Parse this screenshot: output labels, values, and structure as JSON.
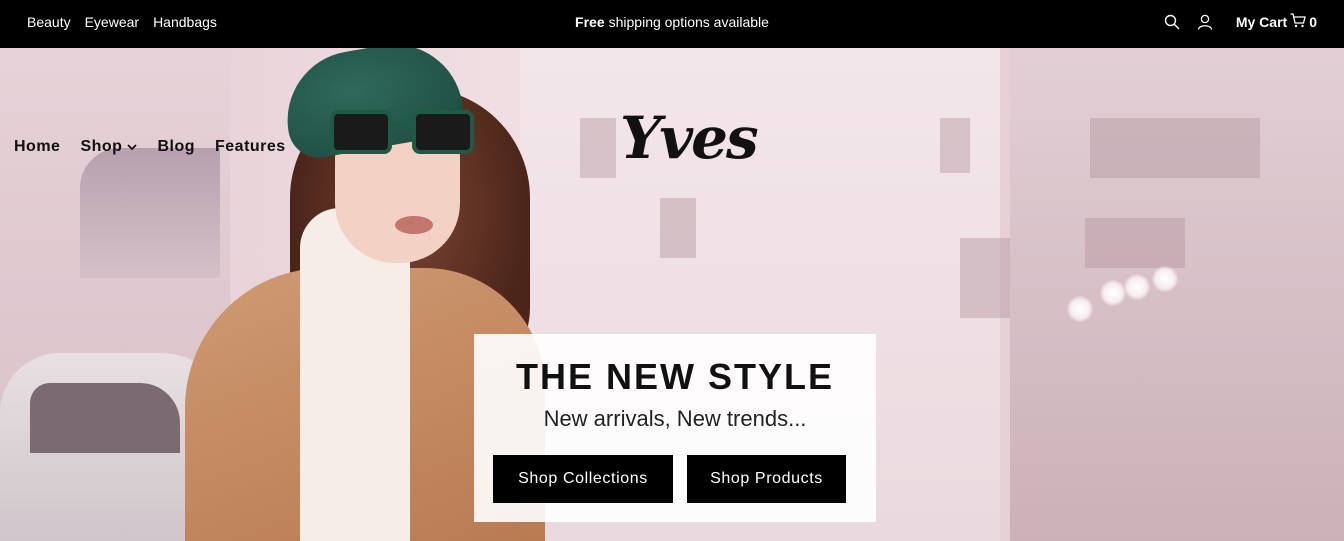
{
  "topbar": {
    "links": [
      "Beauty",
      "Eyewear",
      "Handbags"
    ],
    "announcement_bold": "Free",
    "announcement_rest": "shipping options available",
    "cart_label": "My Cart",
    "cart_count": "0"
  },
  "nav": {
    "items": [
      "Home",
      "Shop",
      "Blog",
      "Features"
    ]
  },
  "logo": "Yves",
  "hero": {
    "title": "THE NEW STYLE",
    "subtitle": "New arrivals, New trends...",
    "button_collections": "Shop Collections",
    "button_products": "Shop Products"
  },
  "icons": {
    "search": "search-icon",
    "user": "user-icon",
    "cart": "cart-icon",
    "chevron": "chevron-down-icon"
  },
  "colors": {
    "topbar_bg": "#000000",
    "button_bg": "#000000",
    "text": "#111111"
  }
}
